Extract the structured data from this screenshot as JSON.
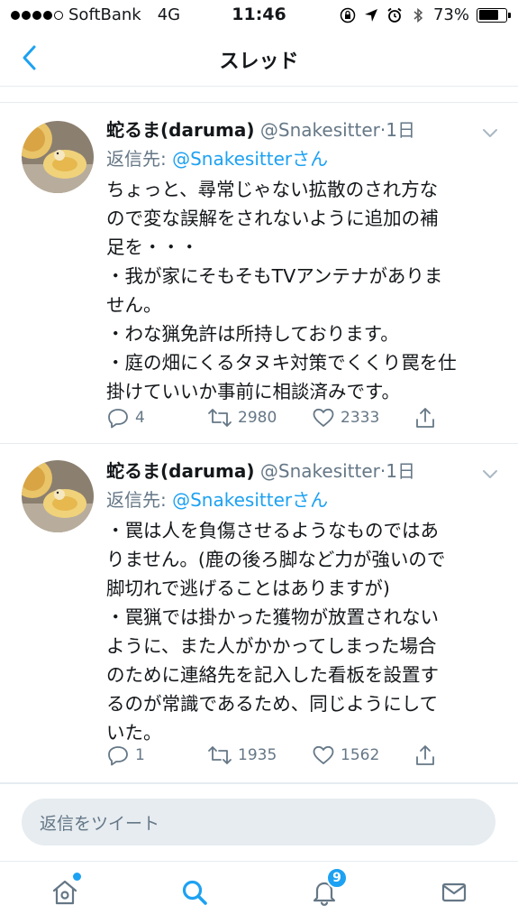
{
  "status_bar": {
    "carrier": "SoftBank",
    "network": "4G",
    "time": "11:46",
    "battery_percent": "73%",
    "battery_level": 0.73,
    "signal_bars": 4,
    "icons": [
      "rotation-lock-icon",
      "location-arrow-icon",
      "alarm-icon",
      "bluetooth-icon"
    ]
  },
  "header": {
    "title": "スレッド",
    "back_icon": "chevron-left-icon"
  },
  "tweets": [
    {
      "name": "蛇るま(daruma)",
      "handle": "@Snakesitter",
      "time": "·1日",
      "reply_label": "返信先: ",
      "reply_mention": "@Snakesitterさん",
      "body_lines": [
        "ちょっと、尋常じゃない拡散のされ方な",
        "ので変な誤解をされないように追加の補",
        "足を・・・",
        "・我が家にそもそもTVアンテナがありま",
        "せん。",
        "・わな猟免許は所持しております。",
        "・庭の畑にくるタヌキ対策でくくり罠を仕",
        "掛けていいか事前に相談済みです。"
      ],
      "replies": "4",
      "retweets": "2980",
      "likes": "2333"
    },
    {
      "name": "蛇るま(daruma)",
      "handle": "@Snakesitter",
      "time": "·1日",
      "reply_label": "返信先: ",
      "reply_mention": "@Snakesitterさん",
      "body_lines": [
        "・罠は人を負傷させるようなものではあ",
        "りません。(鹿の後ろ脚など力が強いので",
        "脚切れで逃げることはありますが)",
        "・罠猟では掛かった獲物が放置されない",
        "ように、また人がかかってしまった場合",
        "のために連絡先を記入した看板を設置す",
        "るのが常識であるため、同じようにして",
        "いた。"
      ],
      "replies": "1",
      "retweets": "1935",
      "likes": "1562"
    }
  ],
  "reply_bar": {
    "placeholder": "返信をツイート"
  },
  "tab_bar": {
    "notification_count": "9",
    "tabs": [
      "home-icon",
      "search-icon",
      "bell-icon",
      "mail-icon"
    ]
  },
  "colors": {
    "accent": "#1da1f2",
    "secondary_text": "#657786",
    "divider": "#e6ecf0"
  }
}
